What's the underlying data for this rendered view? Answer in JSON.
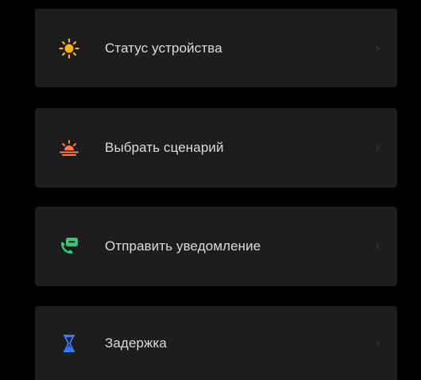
{
  "menu": {
    "items": [
      {
        "label": "Статус устройства",
        "icon": "sun-icon",
        "icon_color": "#f5b21a"
      },
      {
        "label": "Выбрать сценарий",
        "icon": "sunset-icon",
        "icon_color": "#ff7a4d"
      },
      {
        "label": "Отправить уведомление",
        "icon": "phone-message-icon",
        "icon_color": "#2ecc71"
      },
      {
        "label": "Задержка",
        "icon": "hourglass-icon",
        "icon_color": "#3a7bff"
      }
    ],
    "chevron": "›"
  },
  "colors": {
    "background": "#000000",
    "card": "#1d1d1f",
    "text": "#dcdcdc",
    "chevron": "#3a3a3c"
  }
}
